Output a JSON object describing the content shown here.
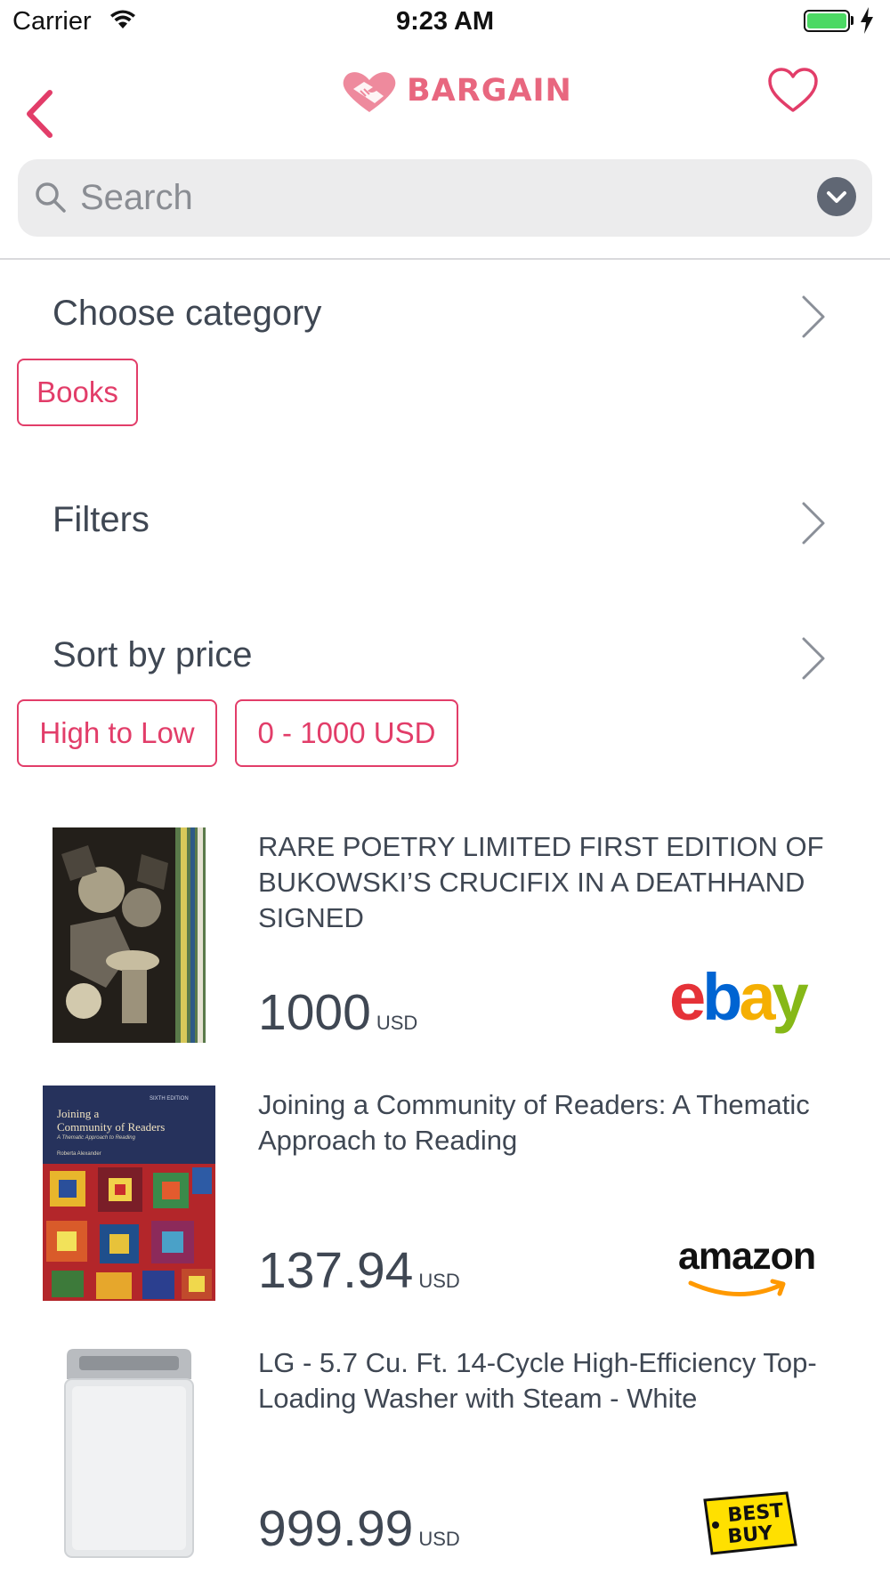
{
  "status_bar": {
    "carrier": "Carrier",
    "time": "9:23 AM"
  },
  "nav": {
    "brand": "BARGAIN"
  },
  "search": {
    "placeholder": "Search"
  },
  "category": {
    "label": "Choose category",
    "selected": "Books"
  },
  "filters": {
    "label": "Filters"
  },
  "sort": {
    "label": "Sort by price",
    "order": "High to Low",
    "range": "0 - 1000 USD"
  },
  "products": [
    {
      "title": "RARE POETRY LIMITED FIRST EDITION OF BUKOWSKI’S CRUCIFIX IN A DEATHHAND SIGNED",
      "price": "1000",
      "currency": "USD",
      "store": "ebay"
    },
    {
      "title": "Joining a Community of Readers: A Thematic Approach to Reading",
      "price": "137.94",
      "currency": "USD",
      "store": "amazon"
    },
    {
      "title": "LG - 5.7 Cu. Ft. 14-Cycle High-Efficiency Top-Loading Washer with Steam - White",
      "price": "999.99",
      "currency": "USD",
      "store": "BEST BUY"
    }
  ],
  "book_cover": {
    "title_line1": "Joining a",
    "title_line2": "Community of Readers",
    "subtitle": "A Thematic Approach to Reading",
    "author": "Roberta Alexander",
    "edition": "SIXTH EDITION"
  },
  "colors": {
    "accent": "#e23d69",
    "brand": "#e8677f",
    "text": "#3f4753",
    "search_bg": "#ececed",
    "battery": "#4cd964"
  },
  "icons": [
    "wifi-icon",
    "battery-icon",
    "charging-icon",
    "back-chevron-icon",
    "brand-logo-icon",
    "heart-icon",
    "search-icon",
    "dropdown-icon",
    "chevron-right-icon"
  ]
}
